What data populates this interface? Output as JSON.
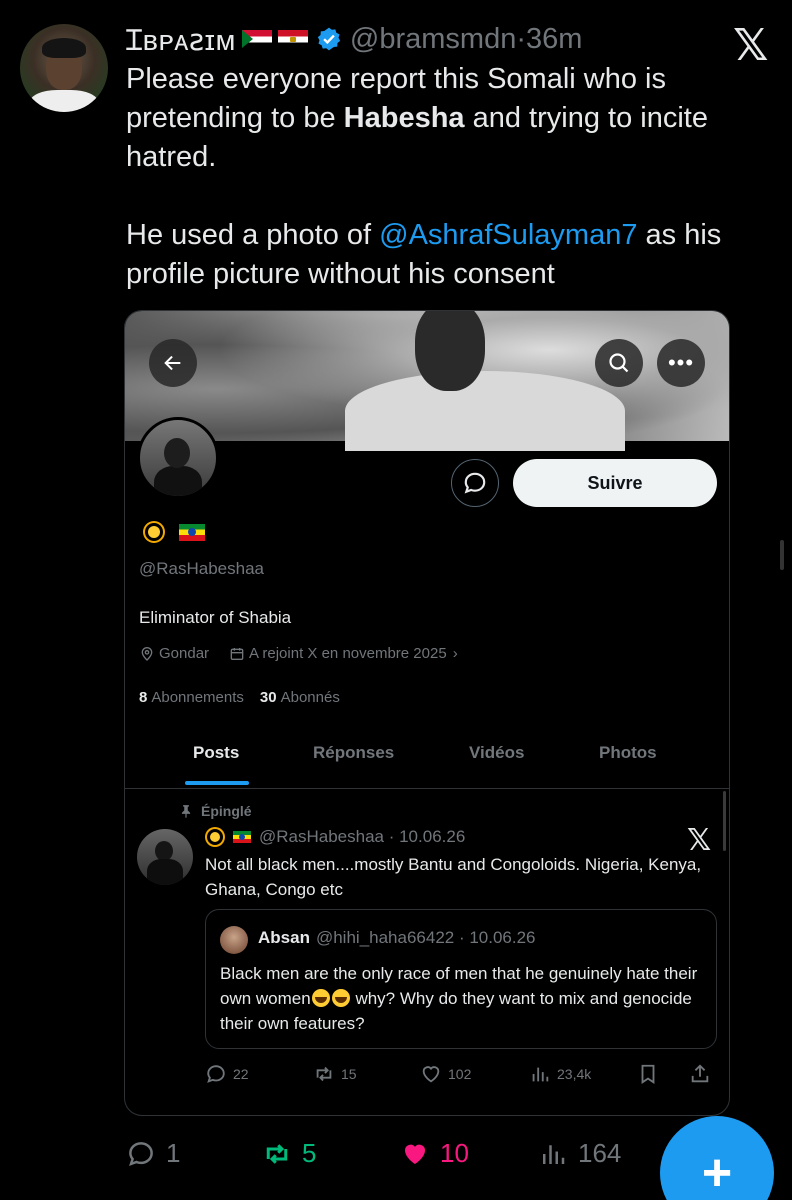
{
  "tweet": {
    "display_name": "Ɪʙᴘᴀꙅɪᴍ",
    "handle": "@bramsmdn",
    "separator": "·",
    "time": "36m",
    "text_line1": "Please everyone report this Somali who is",
    "text_line2_a": "pretending to be ",
    "text_line2_b": "Habesha",
    "text_line2_c": " and trying to incite",
    "text_line3": "hatred.",
    "text_line4_a": "He used a photo of ",
    "text_line4_mention": "@AshrafSulayman7",
    "text_line4_b": " as his",
    "text_line5": "profile picture without his consent"
  },
  "profile": {
    "handle": "@RasHabeshaa",
    "bio": "Eliminator of Shabia",
    "location": "Gondar",
    "joined": "A rejoint X en novembre 2025",
    "following_count": "8",
    "following_label": "Abonnements",
    "followers_count": "30",
    "followers_label": "Abonnés",
    "follow_label": "Suivre",
    "tabs": [
      {
        "label": "Posts"
      },
      {
        "label": "Réponses"
      },
      {
        "label": "Vidéos"
      },
      {
        "label": "Photos"
      }
    ]
  },
  "pinned_post": {
    "pinned_label": "Épinglé",
    "handle_date": "@RasHabeshaa · 10.06.26",
    "text": "Not all black men....mostly Bantu and Congoloids. Nigeria, Kenya, Ghana, Congo etc",
    "quote": {
      "name": "Absan",
      "handle_date": "@hihi_haha66422 · 10.06.26",
      "text_a": "Black men are the only race of men that he genuinely hate their own women",
      "text_b": " why? Why do they want to mix and genocide their own features?"
    },
    "replies": "22",
    "reposts": "15",
    "likes": "102",
    "views": "23,4k"
  },
  "main_actions": {
    "replies": "1",
    "reposts": "5",
    "likes": "10",
    "views": "164"
  },
  "colors": {
    "accent": "#1d9bf0",
    "repost": "#00ba7c",
    "like": "#f91880",
    "muted": "#71767b"
  },
  "icons": [
    "x-logo-icon",
    "verified-icon",
    "back-arrow-icon",
    "search-icon",
    "more-icon",
    "message-icon",
    "location-icon",
    "calendar-icon",
    "pin-icon",
    "reply-icon",
    "repost-icon",
    "like-icon",
    "views-icon",
    "bookmark-icon",
    "share-icon",
    "compose-icon"
  ],
  "fab_label": "+"
}
